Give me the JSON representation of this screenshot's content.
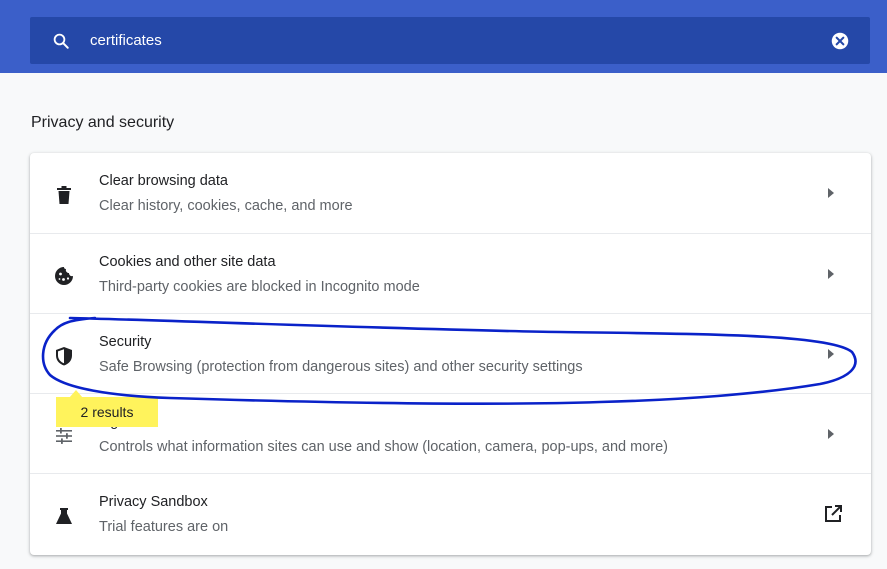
{
  "search": {
    "query": "certificates",
    "search_icon": "search-icon",
    "clear_icon": "clear-search-icon"
  },
  "section": {
    "title": "Privacy and security"
  },
  "rows": [
    {
      "icon": "trash-icon",
      "title": "Clear browsing data",
      "subtitle": "Clear history, cookies, cache, and more",
      "action": "arrow-right-icon"
    },
    {
      "icon": "cookie-icon",
      "title": "Cookies and other site data",
      "subtitle": "Third-party cookies are blocked in Incognito mode",
      "action": "arrow-right-icon"
    },
    {
      "icon": "shield-icon",
      "title": "Security",
      "subtitle": "Safe Browsing (protection from dangerous sites) and other security settings",
      "action": "arrow-right-icon"
    },
    {
      "icon": "tune-icon",
      "title": "ings",
      "subtitle": "Controls what information sites can use and show (location, camera, pop-ups, and more)",
      "action": "arrow-right-icon"
    },
    {
      "icon": "flask-icon",
      "title": "Privacy Sandbox",
      "subtitle": "Trial features are on",
      "action": "open-external-icon"
    }
  ],
  "search_bubble": {
    "text": "2 results"
  },
  "colors": {
    "top_band": "#3b5fc9",
    "search_bar": "#2548a8",
    "bubble": "#fff35c",
    "annotation": "#0a22c9",
    "icon": "#5f6368"
  }
}
